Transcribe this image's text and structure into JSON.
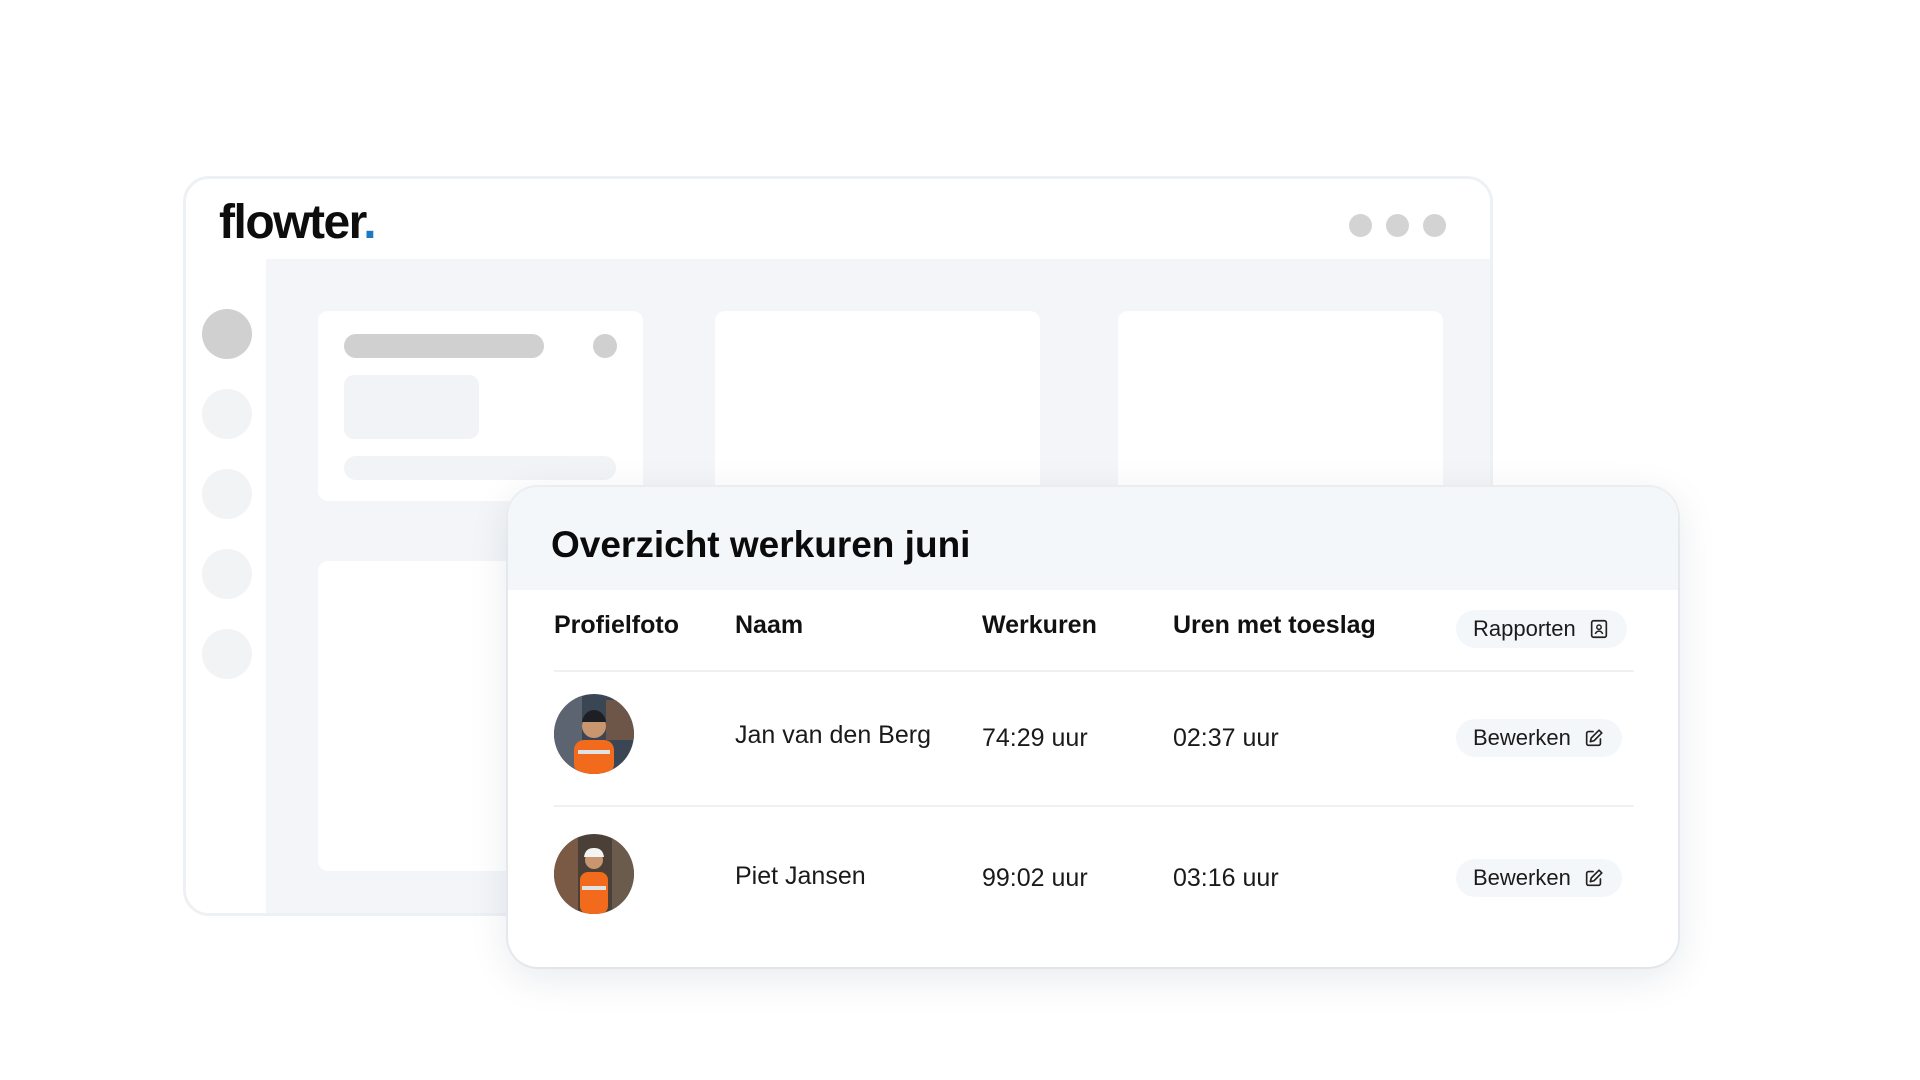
{
  "brand": {
    "logo_text": "flowter",
    "logo_dot": ".",
    "accent_color": "#1e78c2"
  },
  "overview": {
    "title": "Overzicht werkuren juni",
    "columns": {
      "photo": "Profielfoto",
      "name": "Naam",
      "hours": "Werkuren",
      "surcharge": "Uren met toeslag"
    },
    "reports_button": {
      "label": "Rapporten",
      "icon": "report-icon"
    },
    "rows": [
      {
        "name": "Jan van den Berg",
        "hours": "74:29 uur",
        "surcharge": "02:37 uur",
        "action": "Bewerken",
        "action_icon": "edit-icon"
      },
      {
        "name": "Piet Jansen",
        "hours": "99:02 uur",
        "surcharge": "03:16 uur",
        "action": "Bewerken",
        "action_icon": "edit-icon"
      }
    ]
  }
}
